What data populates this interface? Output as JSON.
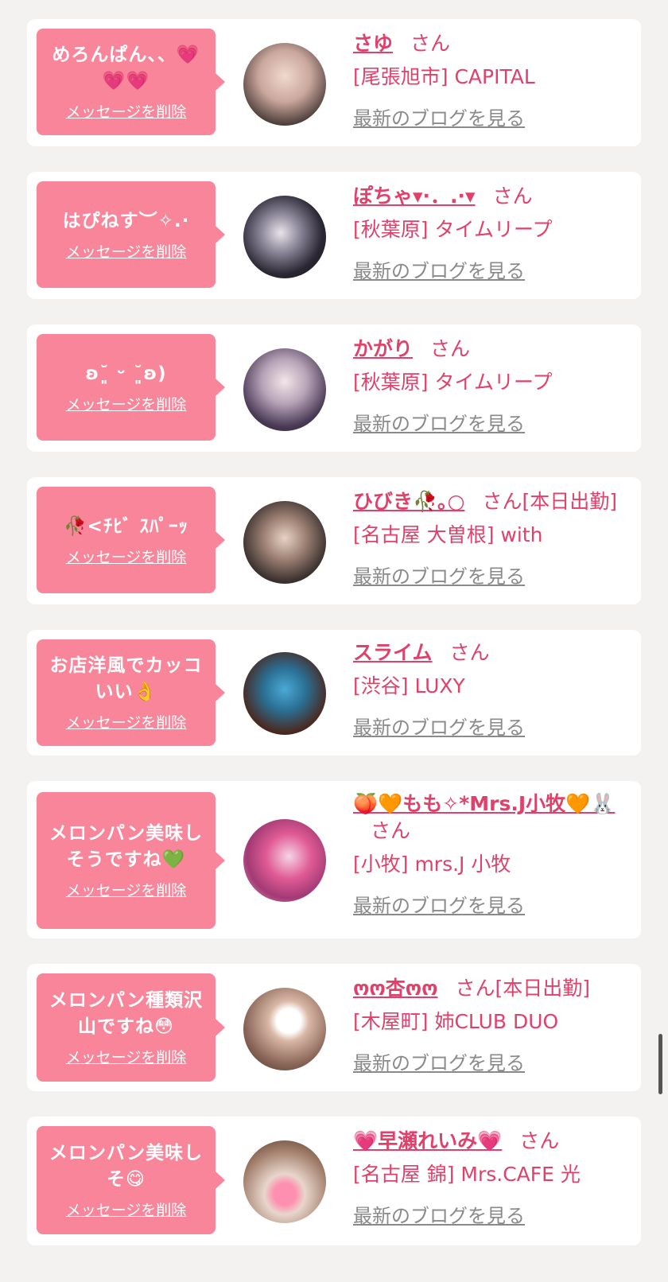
{
  "labels": {
    "delete_message": "メッセージを削除",
    "view_blog": "最新のブログを見る"
  },
  "cards": [
    {
      "message": "めろんぱん、、💗💗💗",
      "name": "さゆ",
      "san": "さん",
      "status": "",
      "shop": "[尾張旭市] CAPITAL"
    },
    {
      "message": "はぴねす︶✧.·",
      "name": "ぽちゃ▾·．.·▾",
      "san": "さん",
      "status": "",
      "shop": "[秋葉原] タイムリープ"
    },
    {
      "message": "ʚ˘͈ ᵕ ˘͈ʚ)",
      "name": "かがり",
      "san": "さん",
      "status": "",
      "shop": "[秋葉原] タイムリープ"
    },
    {
      "message": "🥀<ﾁﾋﾞ ｽﾊﾟｰｯ",
      "name": "ひびき🥀｡○",
      "san": "さん",
      "status": "[本日出勤]",
      "shop": "[名古屋 大曽根] with"
    },
    {
      "message": "お店洋風でカッコいい👌",
      "name": "スライム",
      "san": "さん",
      "status": "",
      "shop": "[渋谷] LUXY"
    },
    {
      "message": "メロンパン美味しそうですね💚",
      "name": "🍑🧡もも✧*Mrs.J小牧🧡🐰",
      "san": "さん",
      "status": "",
      "shop": "[小牧] mrs.J 小牧"
    },
    {
      "message": "メロンパン種類沢山ですね😳",
      "name": "ოო杏ოო",
      "san": "さん",
      "status": "[本日出勤]",
      "shop": "[木屋町] 姉CLUB DUO"
    },
    {
      "message": "メロンパン美味しそ😋",
      "name": "💗早瀬れいみ💗",
      "san": "さん",
      "status": "",
      "shop": "[名古屋 錦] Mrs.CAFE 光"
    }
  ]
}
